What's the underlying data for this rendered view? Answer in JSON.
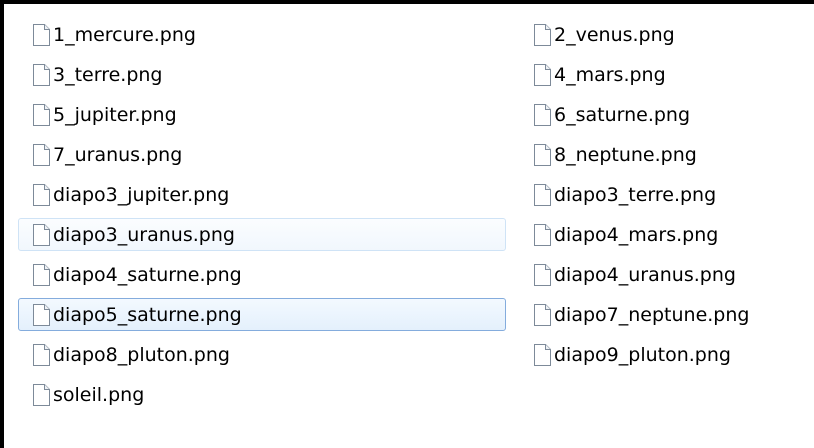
{
  "files": {
    "left_column": [
      "1_mercure.png",
      "3_terre.png",
      "5_jupiter.png",
      "7_uranus.png",
      "diapo3_jupiter.png",
      "diapo3_uranus.png",
      "diapo4_saturne.png",
      "diapo5_saturne.png",
      "diapo8_pluton.png",
      "soleil.png"
    ],
    "right_column": [
      "2_venus.png",
      "4_mars.png",
      "6_saturne.png",
      "8_neptune.png",
      "diapo3_terre.png",
      "diapo4_mars.png",
      "diapo4_uranus.png",
      "diapo7_neptune.png",
      "diapo9_pluton.png"
    ],
    "hovered_item": "diapo3_uranus.png",
    "selected_item": "diapo5_saturne.png",
    "icon": "blank-document-icon"
  },
  "colors": {
    "window_border": "#000000",
    "hover_border": "#cfe3f6",
    "selected_border": "#84acdd",
    "icon_outline": "#7d8a99"
  }
}
